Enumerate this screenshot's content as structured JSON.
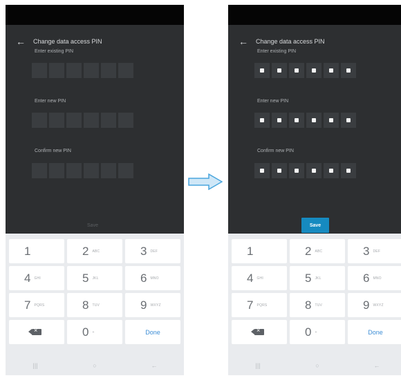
{
  "colors": {
    "screen_bg": "#2d2f31",
    "status_bar": "#050505",
    "pin_box": "#3a3d40",
    "accent": "#168ac0",
    "keyboard_bg": "#e9ebee",
    "done_text": "#3f8fd6"
  },
  "screens": [
    {
      "appbar": {
        "title": "Change data access PIN",
        "back_icon": "arrow-left-icon"
      },
      "fields": [
        {
          "label": "Enter existing PIN",
          "filled": 0
        },
        {
          "label": "Enter new PIN",
          "filled": 0
        },
        {
          "label": "Confirm new PIN",
          "filled": 0
        }
      ],
      "save": {
        "label": "Save",
        "enabled": false
      }
    },
    {
      "appbar": {
        "title": "Change data access PIN",
        "back_icon": "arrow-left-icon"
      },
      "fields": [
        {
          "label": "Enter existing PIN",
          "filled": 6
        },
        {
          "label": "Enter new PIN",
          "filled": 6
        },
        {
          "label": "Confirm new PIN",
          "filled": 6
        }
      ],
      "save": {
        "label": "Save",
        "enabled": true
      }
    }
  ],
  "keyboard": {
    "rows": [
      [
        {
          "num": "1",
          "sub": ""
        },
        {
          "num": "2",
          "sub": "ABC"
        },
        {
          "num": "3",
          "sub": "DEF"
        }
      ],
      [
        {
          "num": "4",
          "sub": "GHI"
        },
        {
          "num": "5",
          "sub": "JKL"
        },
        {
          "num": "6",
          "sub": "MNO"
        }
      ],
      [
        {
          "num": "7",
          "sub": "PQRS"
        },
        {
          "num": "8",
          "sub": "TUV"
        },
        {
          "num": "9",
          "sub": "WXYZ"
        }
      ],
      [
        {
          "special": "backspace"
        },
        {
          "num": "0",
          "sub": "+"
        },
        {
          "special": "done",
          "label": "Done"
        }
      ]
    ]
  },
  "navbar": {
    "icons": [
      "recent-apps-icon",
      "home-icon",
      "back-nav-icon"
    ]
  },
  "transition_arrow": "arrow-right-icon"
}
